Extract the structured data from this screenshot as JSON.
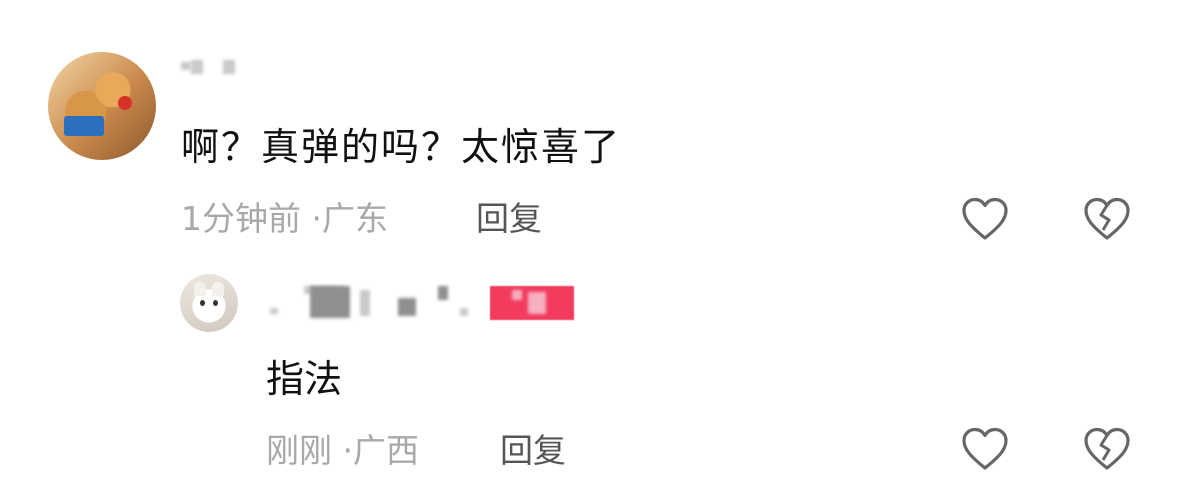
{
  "comments": [
    {
      "text": "啊？真弹的吗？太惊喜了",
      "time": "1分钟前",
      "location": "广东",
      "separator": "·",
      "reply_label": "回复"
    },
    {
      "text": "指法",
      "time": "刚刚",
      "location": "广西",
      "separator": "·",
      "reply_label": "回复"
    }
  ],
  "icons": {
    "like": "heart-outline-icon",
    "dislike": "broken-heart-icon"
  },
  "colors": {
    "text": "#111111",
    "meta": "#a8a8a8",
    "reply": "#555555",
    "icon": "#666666",
    "badge": "#f33b5e"
  }
}
